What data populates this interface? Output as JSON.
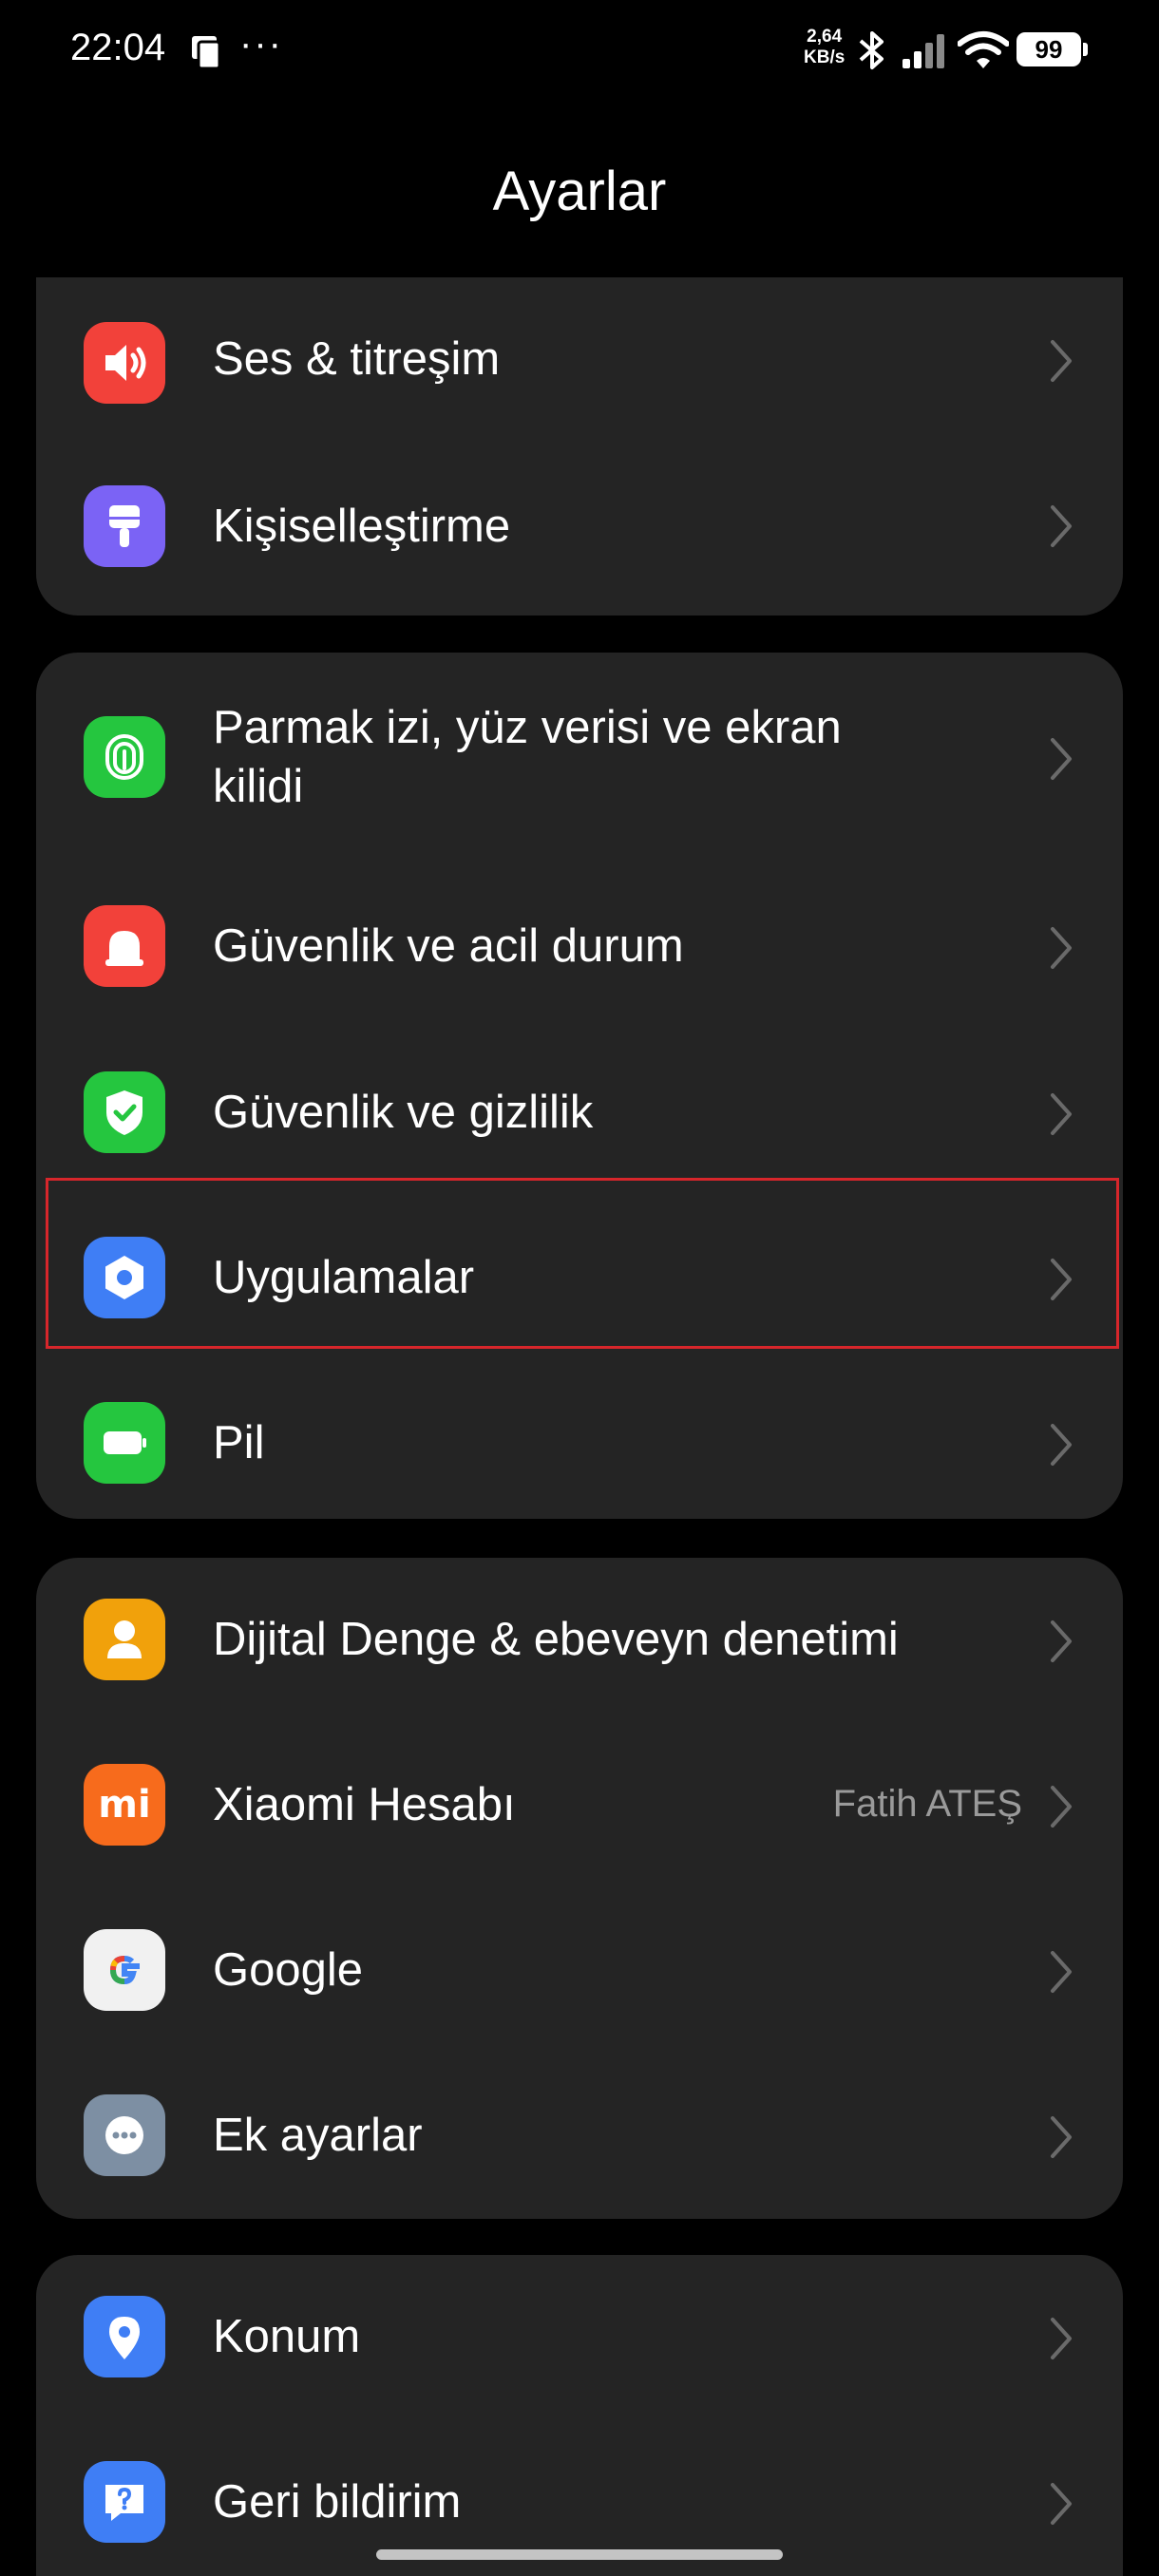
{
  "status_bar": {
    "time": "22:04",
    "dots": "···",
    "net_speed_value": "2,64",
    "net_speed_unit": "KB/s",
    "battery": "99"
  },
  "title": "Ayarlar",
  "items": {
    "sound": {
      "label": "Ses & titreşim",
      "icon": "speaker-icon",
      "color": "#f2413a"
    },
    "personalization": {
      "label": "Kişiselleştirme",
      "icon": "brush-icon",
      "color": "#7b63f5"
    },
    "fingerprint": {
      "label_line1": "Parmak izi, yüz verisi ve ekran",
      "label_line2": "kilidi",
      "icon": "fingerprint-icon",
      "color": "#25c63f"
    },
    "emergency": {
      "label": "Güvenlik ve acil durum",
      "icon": "siren-icon",
      "color": "#f2413a"
    },
    "privacy": {
      "label": "Güvenlik ve gizlilik",
      "icon": "shield-check-icon",
      "color": "#25c63f"
    },
    "apps": {
      "label": "Uygulamalar",
      "icon": "hexagon-icon",
      "color": "#3f7ef5"
    },
    "battery": {
      "label": "Pil",
      "icon": "battery-icon",
      "color": "#25c63f"
    },
    "wellbeing": {
      "label": "Dijital Denge & ebeveyn denetimi",
      "icon": "person-icon",
      "color": "#f1a10b"
    },
    "xiaomi": {
      "label": "Xiaomi Hesabı",
      "value": "Fatih ATEŞ",
      "icon": "mi-logo-icon",
      "icon_text": "mi",
      "color": "#f76b1c"
    },
    "google": {
      "label": "Google",
      "icon": "google-icon",
      "color": "#f1f1f1"
    },
    "more": {
      "label": "Ek ayarlar",
      "icon": "more-dots-icon",
      "color": "#7d8fa3"
    },
    "location": {
      "label": "Konum",
      "icon": "location-pin-icon",
      "color": "#3f7ef5"
    },
    "feedback": {
      "label": "Geri bildirim",
      "icon": "feedback-icon",
      "color": "#3f7ef5"
    }
  },
  "highlighted_item": "apps"
}
